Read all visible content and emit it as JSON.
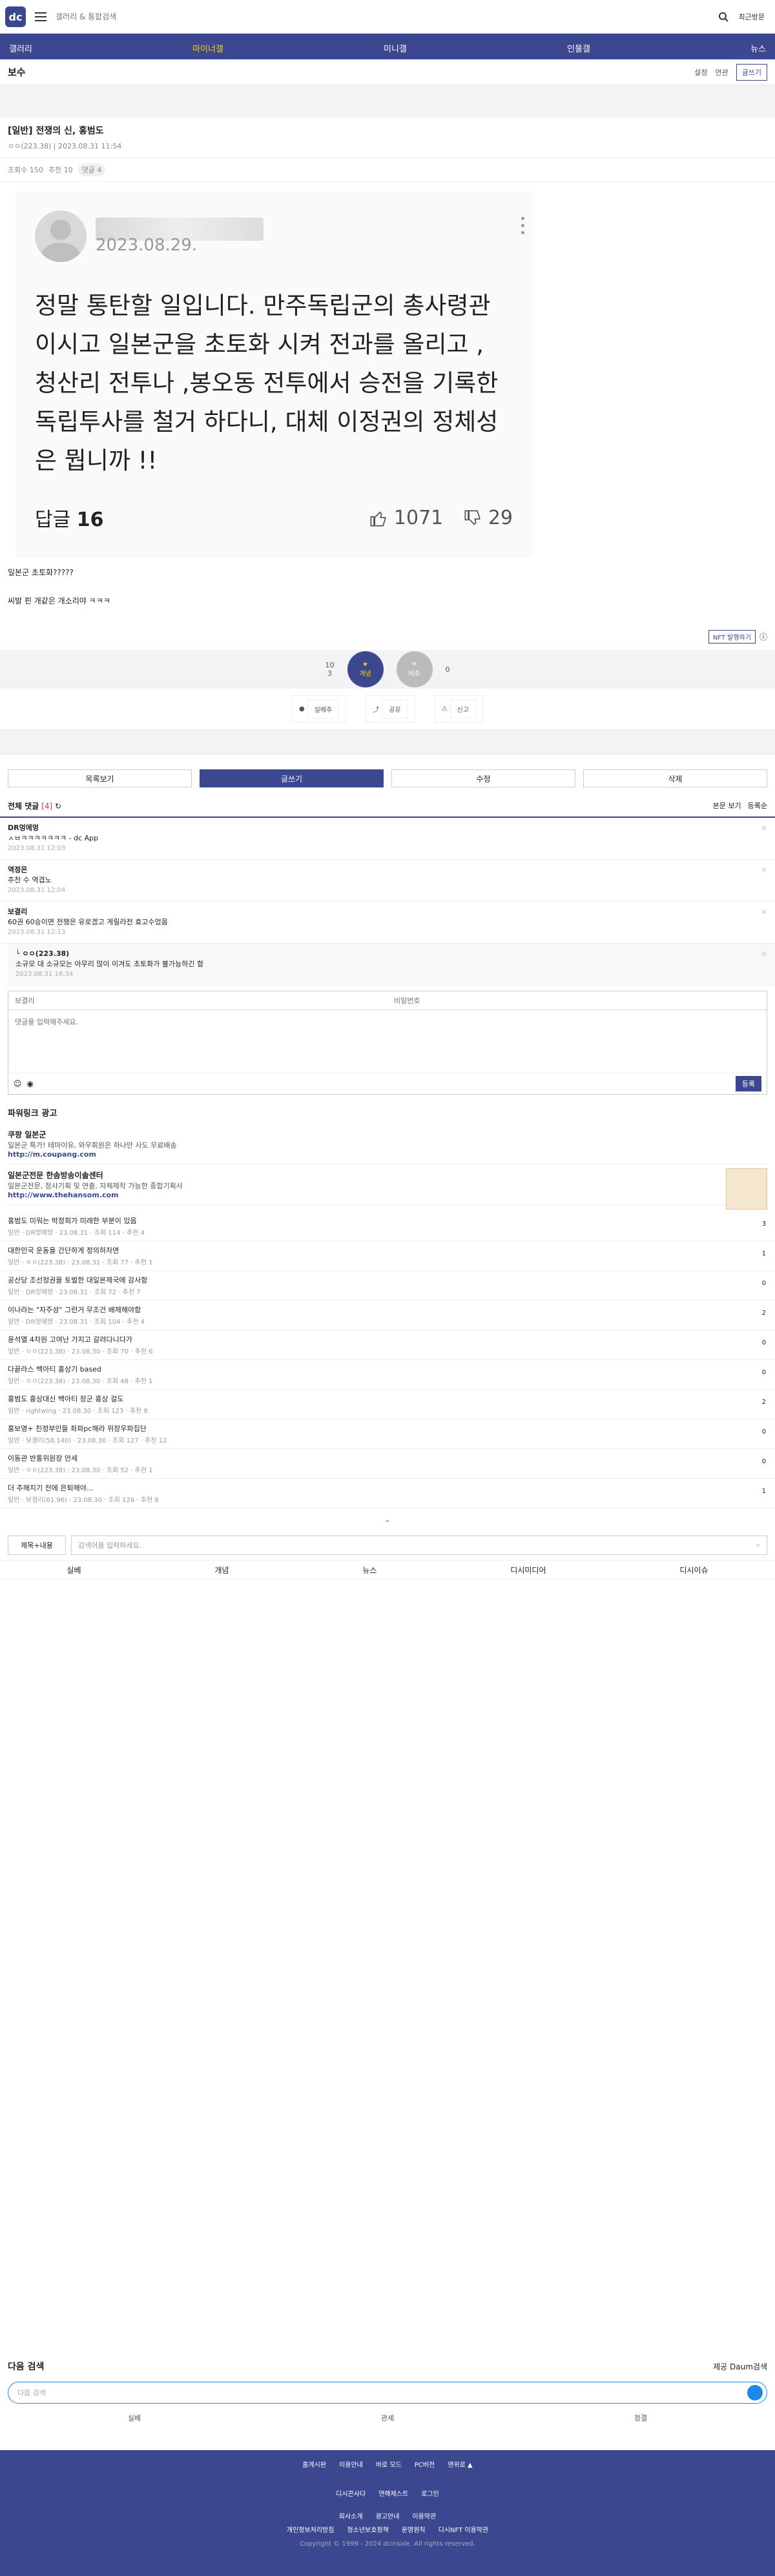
{
  "header": {
    "logo": "dc",
    "search_placeholder": "갤러리 & 통합검색",
    "recent_label": "최근방문"
  },
  "nav": [
    "갤러리",
    "마이너갤",
    "미니갤",
    "인물갤",
    "뉴스"
  ],
  "board": {
    "title": "보수",
    "tools": [
      "설정",
      "연관",
      "글쓰기"
    ]
  },
  "post": {
    "title": "[일반] 전쟁의 신, 홍범도",
    "author": "ㅇㅇ(223.38)",
    "date": "2023.08.31 11:54",
    "views": "조회수 150",
    "recommends": "추천 10",
    "comment_badge": "댓글 4",
    "card": {
      "date": "2023.08.29.",
      "text": "정말 통탄할 일입니다. 만주독립군의 총사령관 이시고 일본군을 초토화 시켜 전과를 올리고 , 청산리 전투나 ,봉오동 전투에서 승전을 기록한 독립투사를 철거 하다니, 대체 이정권의 정체성은 뭡니까 !!",
      "reply_label": "답글",
      "reply_count": "16",
      "likes": "1071",
      "dislikes": "29"
    },
    "body_lines": [
      "일본군 초토화?????",
      "씨발 핀 개같은 개소리야 ㅋㅋㅋ"
    ],
    "nft_label": "NFT 발행하기",
    "rec_up": "10",
    "rec_down": "0",
    "rec_fix": "3",
    "rec_up_label": "개념",
    "rec_down_label": "비추",
    "share": [
      "실베추",
      "공유",
      "신고"
    ]
  },
  "actions": [
    "목록보기",
    "글쓰기",
    "수정",
    "삭제"
  ],
  "comments": {
    "title": "전체 댓글",
    "count": "[4]",
    "sort": [
      "본문 보기",
      "등록순"
    ],
    "items": [
      {
        "nick": "DR멍에멍",
        "text": "ㅅㅂㅋㅋㅋㅋㅋㅋㅋ - dc App",
        "date": "2023.08.31 12:03",
        "reply": false
      },
      {
        "nick": "역정은",
        "text": "추천 수 역겹노",
        "date": "2023.08.31 12:04",
        "reply": false
      },
      {
        "nick": "보결리",
        "text": "60권 60승이면 전쟁은 유로겠고 게릴라전 효고수었음",
        "date": "2023.08.31 12:13",
        "reply": false
      },
      {
        "nick": "ㅇㅇ(223.38)",
        "text": "소규모 대 소규모는 아무리 많이 이겨도 초토화가 불가능하긴 함",
        "date": "2023.08.31 16:34",
        "reply": true
      }
    ],
    "form": {
      "nick_placeholder": "보결리",
      "pw_placeholder": "비밀번호",
      "text_placeholder": "댓글을 입력해주세요.",
      "submit": "등록"
    }
  },
  "ads": {
    "title": "파워링크 광고",
    "items": [
      {
        "t": "쿠팡 일본군",
        "d": "일본군 특가! 테마이유, 와우회원은 하나만 사도 무료배송",
        "u": "http://m.coupang.com"
      },
      {
        "t": "일본군전문 한솜방송이솔센터",
        "d": "일본군전문, 정사기획 및 연출, 자체제작 가능한 종합기획사",
        "u": "http://www.thehansom.com"
      }
    ]
  },
  "list": [
    {
      "t": "홍범도 미워는 박정희가 미래한 부분이 있음",
      "m": "일반 · DR멍에멍 · 23.08.31 · 조회 114 · 추천 4",
      "c": "3"
    },
    {
      "t": "대한민국 운동을 간단하게 정의하자면",
      "m": "일반 · ㅇㅇ(223.38) · 23.08.31 · 조회 77 · 추천 1",
      "c": "1"
    },
    {
      "t": "공산당 조선정권을 토벌한 대일본제국에 감사함",
      "m": "일반 · DR멍에멍 · 23.08.31 · 조회 72 · 추천 7",
      "c": "0"
    },
    {
      "t": "이나라는 \"자주성\" 그런거 무조건 배제해야함",
      "m": "일반 · DR멍에멍 · 23.08.31 · 조회 104 · 추천 4",
      "c": "2"
    },
    {
      "t": "윤석열 4차원 고여난 가지고 갈려다니다가",
      "m": "일반 · ㅇㅇ(223.38) · 23.08.30 · 조회 70 · 추천 6",
      "c": "0"
    },
    {
      "t": "다끝라스 백아티 홍상기 based",
      "m": "일반 · ㅇㅇ(223.38) · 23.08.30 · 조회 48 · 추천 1",
      "c": "0"
    },
    {
      "t": "홍범도 흉상대신 백아티 장군 흉상 걸도",
      "m": "일반 · rightwing · 23.08.30 · 조회 123 · 추천 8",
      "c": "2"
    },
    {
      "t": "홍보영+ 친정부인들 좌파pc해라 위장우파집단",
      "m": "일반 · 보결리(58.140) · 23.08.30 · 조회 127 · 추천 12",
      "c": "0"
    },
    {
      "t": "이동관 반통위원장 안세",
      "m": "일반 · ㅇㅇ(223.38) · 23.08.30 · 조회 52 · 추천 1",
      "c": "0"
    },
    {
      "t": "더 추해지기 전에 은퇴해야...",
      "m": "일반 · 보결리(61.96) · 23.08.30 · 조회 126 · 추천 8",
      "c": "1"
    }
  ],
  "search_bottom": {
    "select": "제목+내용",
    "placeholder": "검색어를 입력하세요."
  },
  "categories": [
    "실베",
    "개념",
    "뉴스",
    "디시미디어",
    "디시이슈"
  ],
  "daum": {
    "title": "다음 검색",
    "right": "제공 Daum검색",
    "placeholder": "다음 검색",
    "keys": [
      "실베",
      "관세",
      "정결"
    ]
  },
  "footer": {
    "row1": [
      "홈게시판",
      "이용안내",
      "바로 모드",
      "PC버전",
      "맨위로 ▲"
    ],
    "row2": [
      "디시콘사다",
      "연해제스트",
      "로그인"
    ],
    "row3": [
      "회사소개",
      "광고안내",
      "이용약관"
    ],
    "row4": [
      "개인정보처리방침",
      "청소년보호정책",
      "운영원칙",
      "디시NFT 이용약관"
    ],
    "copyright": "Copyright © 1999 - 2024 dcinside. All rights reserved."
  }
}
